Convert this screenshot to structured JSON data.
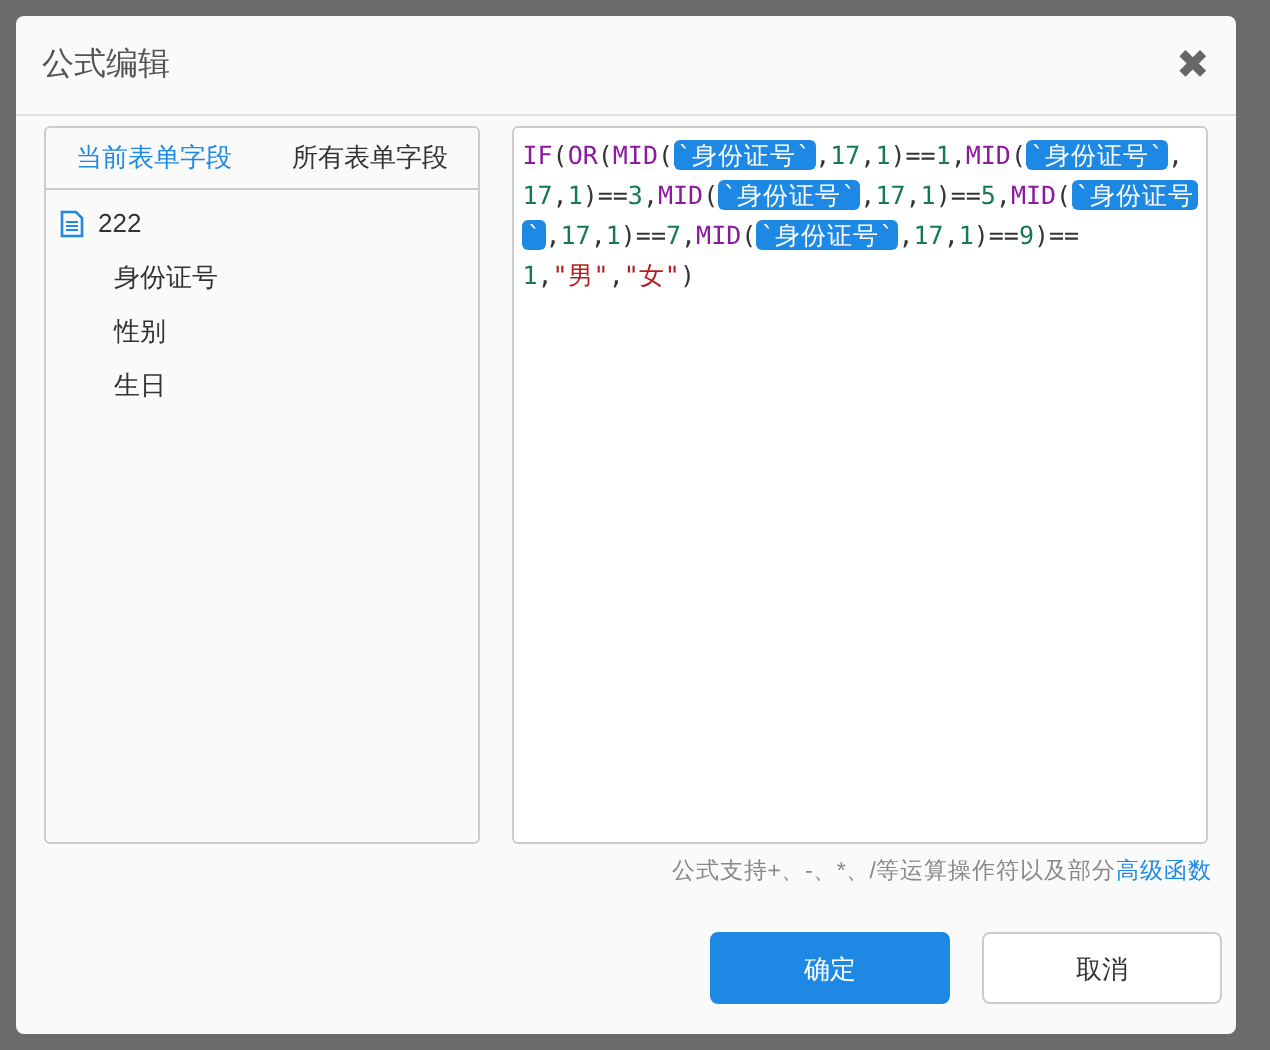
{
  "dialog": {
    "title": "公式编辑",
    "close": "✖"
  },
  "field_tabs": [
    {
      "label": "当前表单字段",
      "selected": true
    },
    {
      "label": "所有表单字段",
      "selected": false
    }
  ],
  "field_tree": [
    {
      "label": "222",
      "children": [
        {
          "label": "身份证号"
        },
        {
          "label": "性别"
        },
        {
          "label": "生日"
        }
      ]
    }
  ],
  "formula": {
    "tokens": [
      {
        "kind": "func",
        "text": "IF"
      },
      {
        "kind": "op",
        "text": "("
      },
      {
        "kind": "func",
        "text": "OR"
      },
      {
        "kind": "op",
        "text": "("
      },
      {
        "kind": "func",
        "text": "MID"
      },
      {
        "kind": "op",
        "text": "("
      },
      {
        "kind": "field",
        "text": "`身份证号`"
      },
      {
        "kind": "op",
        "text": ","
      },
      {
        "kind": "num",
        "text": "17"
      },
      {
        "kind": "op",
        "text": ","
      },
      {
        "kind": "num",
        "text": "1"
      },
      {
        "kind": "op",
        "text": ")=="
      },
      {
        "kind": "num",
        "text": "1"
      },
      {
        "kind": "op",
        "text": ","
      },
      {
        "kind": "func",
        "text": "MID"
      },
      {
        "kind": "op",
        "text": "("
      },
      {
        "kind": "field",
        "text": "`身份证号`"
      },
      {
        "kind": "op",
        "text": ","
      },
      {
        "kind": "num",
        "text": "17"
      },
      {
        "kind": "op",
        "text": ","
      },
      {
        "kind": "num",
        "text": "1"
      },
      {
        "kind": "op",
        "text": ")=="
      },
      {
        "kind": "num",
        "text": "3"
      },
      {
        "kind": "op",
        "text": ","
      },
      {
        "kind": "func",
        "text": "MID"
      },
      {
        "kind": "op",
        "text": "("
      },
      {
        "kind": "field",
        "text": "`身份证号`"
      },
      {
        "kind": "op",
        "text": ","
      },
      {
        "kind": "num",
        "text": "17"
      },
      {
        "kind": "op",
        "text": ","
      },
      {
        "kind": "num",
        "text": "1"
      },
      {
        "kind": "op",
        "text": ")=="
      },
      {
        "kind": "num",
        "text": "5"
      },
      {
        "kind": "op",
        "text": ","
      },
      {
        "kind": "func",
        "text": "MID"
      },
      {
        "kind": "op",
        "text": "("
      },
      {
        "kind": "field",
        "text": "`身份证号`"
      },
      {
        "kind": "op",
        "text": ","
      },
      {
        "kind": "num",
        "text": "17"
      },
      {
        "kind": "op",
        "text": ","
      },
      {
        "kind": "num",
        "text": "1"
      },
      {
        "kind": "op",
        "text": ")=="
      },
      {
        "kind": "num",
        "text": "7"
      },
      {
        "kind": "op",
        "text": ","
      },
      {
        "kind": "func",
        "text": "MID"
      },
      {
        "kind": "op",
        "text": "("
      },
      {
        "kind": "field",
        "text": "`身份证号`"
      },
      {
        "kind": "op",
        "text": ","
      },
      {
        "kind": "num",
        "text": "17"
      },
      {
        "kind": "op",
        "text": ","
      },
      {
        "kind": "num",
        "text": "1"
      },
      {
        "kind": "op",
        "text": ")=="
      },
      {
        "kind": "num",
        "text": "9"
      },
      {
        "kind": "op",
        "text": ")=="
      },
      {
        "kind": "num",
        "text": "1"
      },
      {
        "kind": "op",
        "text": ","
      },
      {
        "kind": "string",
        "text": "\"男\""
      },
      {
        "kind": "op",
        "text": ","
      },
      {
        "kind": "string",
        "text": "\"女\""
      },
      {
        "kind": "op",
        "text": ")"
      }
    ]
  },
  "hint": {
    "text": "公式支持+、-、*、/等运算操作符以及部分",
    "link": "高级函数"
  },
  "buttons": [
    {
      "label": "确定",
      "kind": "primary"
    },
    {
      "label": "取消",
      "kind": "secondary"
    }
  ]
}
